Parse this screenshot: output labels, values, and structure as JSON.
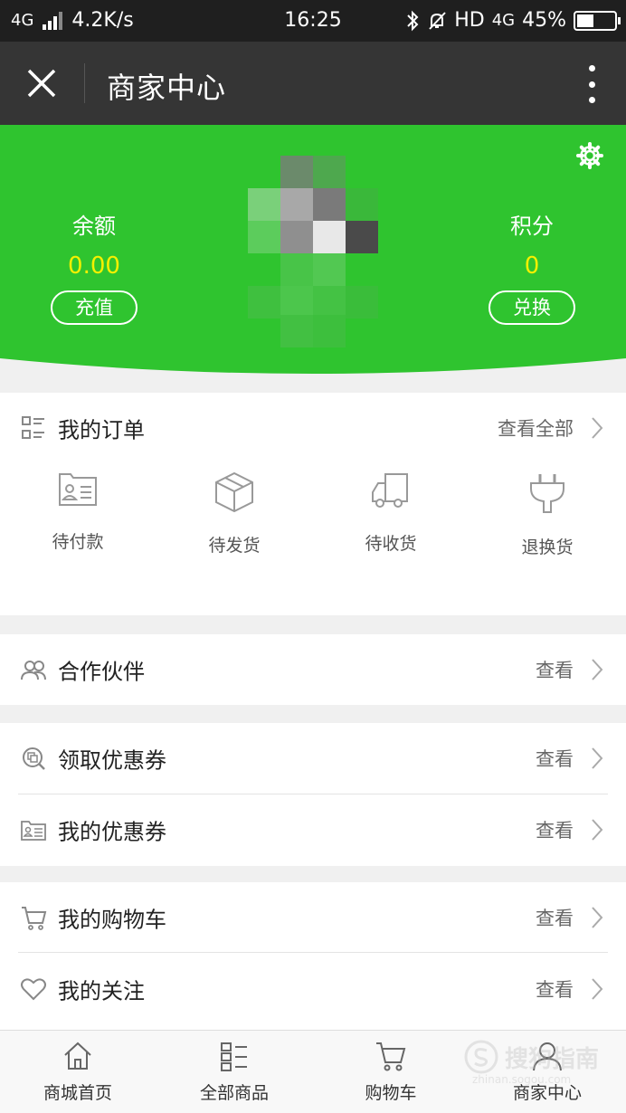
{
  "status_bar": {
    "network_type": "4G",
    "speed": "4.2K/s",
    "time": "16:25",
    "hd_label": "HD",
    "network_type_right": "4G",
    "battery": "45%",
    "battery_level": 0.45
  },
  "navbar": {
    "title": "商家中心",
    "close_icon": "close-icon",
    "more_icon": "more-vertical-icon"
  },
  "header": {
    "background_color": "#2fc42f",
    "balance_label": "余额",
    "balance_value": "0.00",
    "recharge_label": "充值",
    "points_label": "积分",
    "points_value": "0",
    "exchange_label": "兑换",
    "settings_icon": "gear-icon"
  },
  "orders": {
    "title": "我的订单",
    "view_all": "查看全部",
    "items": [
      {
        "label": "待付款",
        "icon": "id-card-icon"
      },
      {
        "label": "待发货",
        "icon": "box-icon"
      },
      {
        "label": "待收货",
        "icon": "truck-icon"
      },
      {
        "label": "退换货",
        "icon": "plug-icon"
      }
    ]
  },
  "partners": {
    "label": "合作伙伴",
    "more": "查看"
  },
  "coupons": {
    "claim_label": "领取优惠券",
    "claim_more": "查看",
    "mine_label": "我的优惠券",
    "mine_more": "查看"
  },
  "shopping": {
    "cart_label": "我的购物车",
    "cart_more": "查看",
    "follow_label": "我的关注",
    "follow_more": "查看"
  },
  "tabbar": {
    "tabs": [
      {
        "label": "商城首页",
        "icon": "home-icon"
      },
      {
        "label": "全部商品",
        "icon": "list-icon"
      },
      {
        "label": "购物车",
        "icon": "cart-icon"
      },
      {
        "label": "商家中心",
        "icon": "user-icon"
      }
    ]
  },
  "watermark": {
    "text": "搜狗指南",
    "url": "zhinan.sogou.com"
  }
}
